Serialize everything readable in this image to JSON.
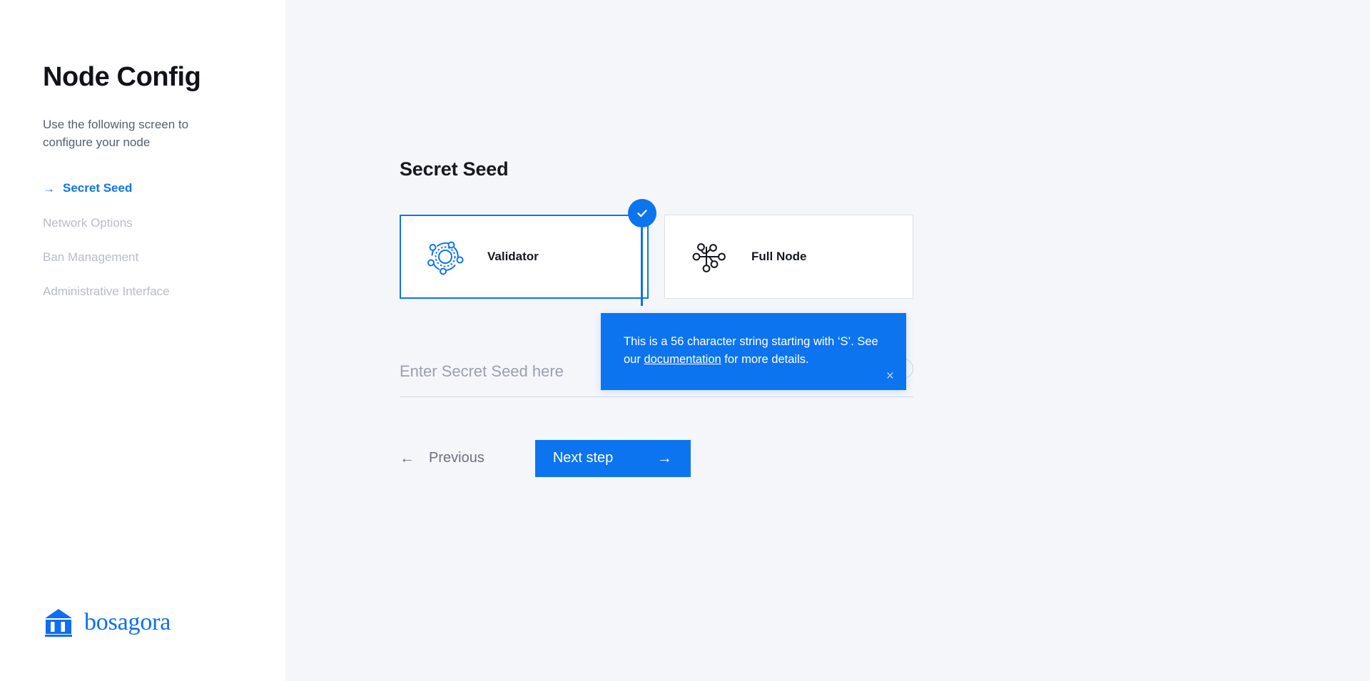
{
  "sidebar": {
    "title": "Node Config",
    "subtitle": "Use the following screen to configure your node",
    "active_arrow": "→",
    "items": [
      {
        "label": "Secret Seed",
        "active": true
      },
      {
        "label": "Network Options",
        "active": false
      },
      {
        "label": "Ban Management",
        "active": false
      },
      {
        "label": "Administrative Interface",
        "active": false
      }
    ],
    "brand": {
      "name": "bosagora",
      "color": "#0d6ef0"
    }
  },
  "main": {
    "section_title": "Secret Seed",
    "cards": [
      {
        "label": "Validator",
        "selected": true,
        "icon": "validator-network-icon"
      },
      {
        "label": "Full Node",
        "selected": false,
        "icon": "full-node-network-icon"
      }
    ],
    "selected_badge_icon": "check-icon",
    "tooltip": {
      "text_before": "This is a 56 character string starting with ‘S’. See our ",
      "link": "documentation",
      "text_after": " for more details.",
      "close_icon": "×",
      "background": "#0d74f0"
    },
    "seed_field": {
      "value": "",
      "placeholder": "Enter Secret Seed here",
      "help_label": "?"
    },
    "actions": {
      "previous_label": "Previous",
      "previous_arrow": "←",
      "next_label": "Next step",
      "next_arrow": "→",
      "next_color": "#0d74f0"
    }
  }
}
